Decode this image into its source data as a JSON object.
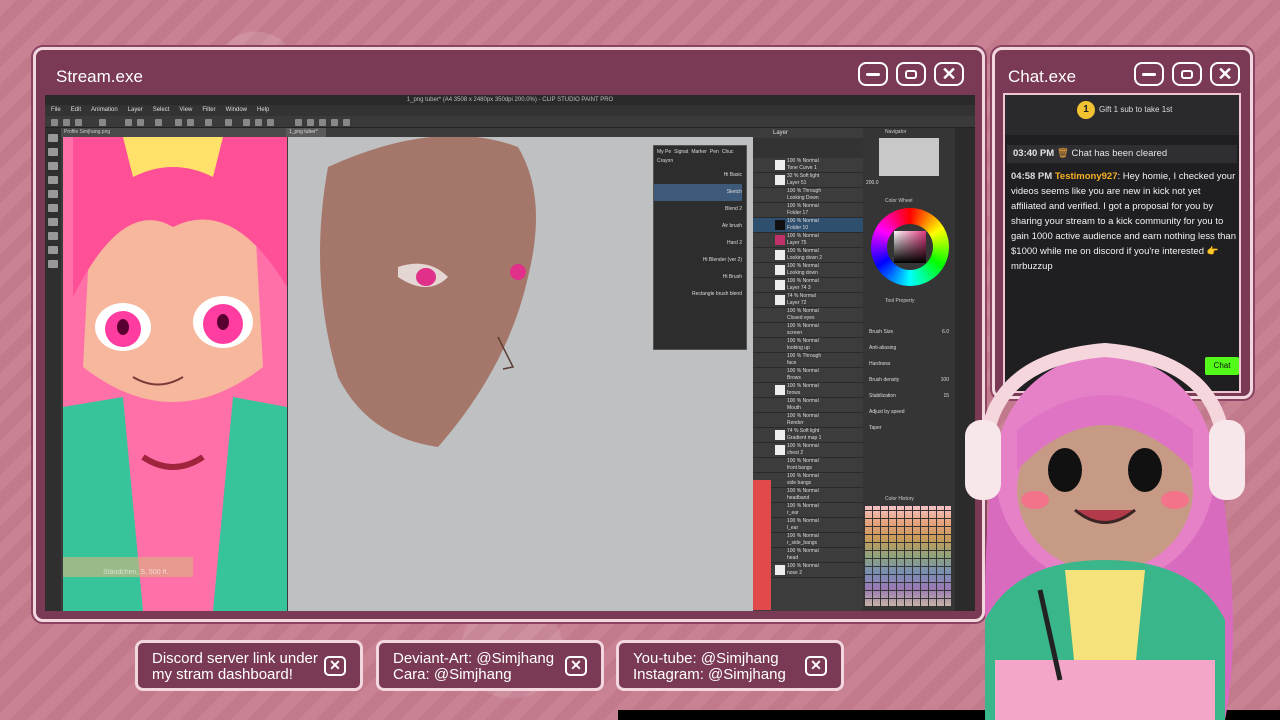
{
  "stream_window": {
    "title": "Stream.exe"
  },
  "chat_window": {
    "title": "Chat.exe"
  },
  "app": {
    "title": "1_png tuber* (A4 3508 x 2480px 350dpi 200.0%) - CLIP STUDIO PAINT PRO",
    "menu": [
      "File",
      "Edit",
      "Animation",
      "Layer",
      "Select",
      "View",
      "Filter",
      "Window",
      "Help"
    ],
    "ref_tab": "Profile Simjhang.png",
    "canvas_tab": "1_png tuber*",
    "reference_caption": "Ständchen, S. 500 ff.",
    "sub_tool_tabs": [
      "My Pe",
      "Signat",
      "Marker",
      "Pen",
      "Chuc",
      "Crayon"
    ],
    "brushes": [
      "Hi Basic",
      "Sketch",
      "Blend 2",
      "Air brush",
      "Hard 2",
      "Hi Blender (ver 2)",
      "Hi Brush",
      "Rectangle brush blend"
    ],
    "layers": [
      {
        "mode": "100 % Normal",
        "name": "Tone Curve 1"
      },
      {
        "mode": "32 % Soft light",
        "name": "Layer 51"
      },
      {
        "mode": "100 % Through",
        "name": "Looking Down"
      },
      {
        "mode": "100 % Normal",
        "name": "Folder 17"
      },
      {
        "mode": "100 % Normal",
        "name": "Folder 10"
      },
      {
        "mode": "100 % Normal",
        "name": "Layer 75"
      },
      {
        "mode": "100 % Normal",
        "name": "Looking down 2"
      },
      {
        "mode": "100 % Normal",
        "name": "Looking down"
      },
      {
        "mode": "100 % Normal",
        "name": "Layer 74 3"
      },
      {
        "mode": "74 % Normal",
        "name": "Layer 72"
      },
      {
        "mode": "100 % Normal",
        "name": "Closed eyes"
      },
      {
        "mode": "100 % Normal",
        "name": "screen"
      },
      {
        "mode": "100 % Normal",
        "name": "looking up"
      },
      {
        "mode": "100 % Through",
        "name": "face"
      },
      {
        "mode": "100 % Normal",
        "name": "Brows"
      },
      {
        "mode": "100 % Normal",
        "name": "brows"
      },
      {
        "mode": "100 % Normal",
        "name": "Mouth"
      },
      {
        "mode": "100 % Normal",
        "name": "Render"
      },
      {
        "mode": "74 % Soft light",
        "name": "Gradient map 1"
      },
      {
        "mode": "100 % Normal",
        "name": "chest 2"
      },
      {
        "mode": "100 % Normal",
        "name": "front bangs"
      },
      {
        "mode": "100 % Normal",
        "name": "side bangs"
      },
      {
        "mode": "100 % Normal",
        "name": "headband"
      },
      {
        "mode": "100 % Normal",
        "name": "r_ear"
      },
      {
        "mode": "100 % Normal",
        "name": "l_ear"
      },
      {
        "mode": "100 % Normal",
        "name": "r_side_bangs"
      },
      {
        "mode": "100 % Normal",
        "name": "head"
      },
      {
        "mode": "100 % Normal",
        "name": "nose 2"
      }
    ],
    "panels": {
      "layer": "Layer",
      "navigator": "Navigator",
      "color_wheel": "Color Wheel",
      "tool_property": "Tool Property",
      "color_history": "Color History"
    },
    "zoom": "200.0",
    "tool_props": [
      {
        "label": "Brush Size",
        "value": "6.0"
      },
      {
        "label": "Anti-aliasing",
        "value": ""
      },
      {
        "label": "Hardness",
        "value": ""
      },
      {
        "label": "Brush density",
        "value": "100"
      },
      {
        "label": "Stabilization",
        "value": "15"
      },
      {
        "label": "Adjust by speed",
        "value": ""
      },
      {
        "label": "Taper",
        "value": ""
      }
    ]
  },
  "chat": {
    "pinned_badge": "1",
    "pinned_text": "Gift 1 sub to take 1st",
    "system_time": "03:40 PM",
    "system_text": "Chat has been cleared",
    "msg_time": "04:58 PM",
    "msg_user": "Testimony927",
    "msg_text": "Hey homie, I checked your videos seems like you are new in kick not yet affiliated and verified. I got a proposal for you by sharing your stream to a kick community for you to gain 1000 active audience and earn nothing less than $1000 while me on discord if you're interested 👉 mrbuzzup",
    "chat_button": "Chat"
  },
  "info_boxes": [
    {
      "line1": "Discord server link under",
      "line2": "my stram dashboard!"
    },
    {
      "line1": "Deviant-Art: @Simjhang",
      "line2": "Cara: @Simjhang"
    },
    {
      "line1": "You-tube: @Simjhang",
      "line2": "Instagram: @Simjhang"
    }
  ],
  "colors": {
    "window_bg": "#7a3a55",
    "window_border": "#f3d7df",
    "page_bg": "#c77d8f",
    "chat_username": "#f6b026",
    "kick_green": "#53fc18"
  },
  "icons": [
    "minimize-icon",
    "maximize-icon",
    "close-icon",
    "crown-icon",
    "pointing-hand-icon"
  ]
}
